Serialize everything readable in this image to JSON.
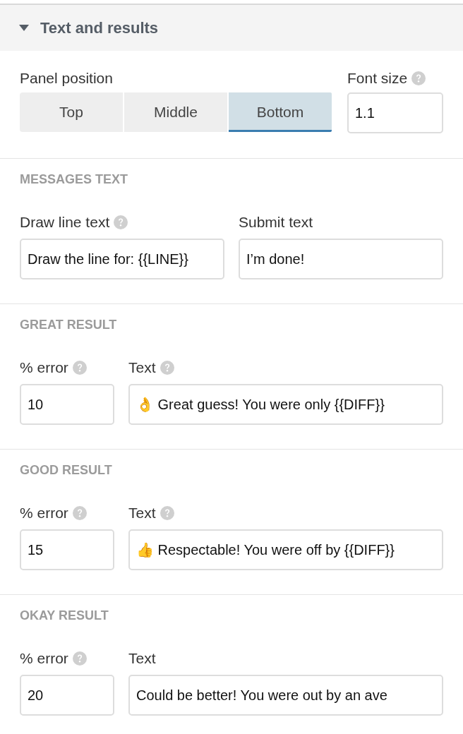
{
  "section": {
    "title": "Text and results",
    "expanded": true
  },
  "panel_position": {
    "label": "Panel position",
    "help": false,
    "options": [
      {
        "label": "Top",
        "selected": false
      },
      {
        "label": "Middle",
        "selected": false
      },
      {
        "label": "Bottom",
        "selected": true
      }
    ]
  },
  "font_size": {
    "label": "Font size",
    "help": true,
    "value": "1.1"
  },
  "groups": [
    {
      "heading": "MESSAGES TEXT",
      "fields": [
        {
          "kind": "text",
          "label": "Draw line text",
          "help": true,
          "value": "Draw the line for: {{LINE}}"
        },
        {
          "kind": "text",
          "label": "Submit text",
          "help": false,
          "value": "I’m done!"
        }
      ]
    },
    {
      "heading": "GREAT RESULT",
      "fields": [
        {
          "kind": "number",
          "label": "% error",
          "help": true,
          "value": "10"
        },
        {
          "kind": "text",
          "label": "Text",
          "help": true,
          "value": "👌 Great guess! You were only {{DIFF}}"
        }
      ]
    },
    {
      "heading": "GOOD RESULT",
      "fields": [
        {
          "kind": "number",
          "label": "% error",
          "help": true,
          "value": "15"
        },
        {
          "kind": "text",
          "label": "Text",
          "help": true,
          "value": "👍 Respectable! You were off by {{DIFF}}"
        }
      ]
    },
    {
      "heading": "OKAY RESULT",
      "fields": [
        {
          "kind": "number",
          "label": "% error",
          "help": true,
          "value": "20"
        },
        {
          "kind": "text",
          "label": "Text",
          "help": false,
          "value": "Could be better! You were out by an ave"
        }
      ]
    }
  ]
}
